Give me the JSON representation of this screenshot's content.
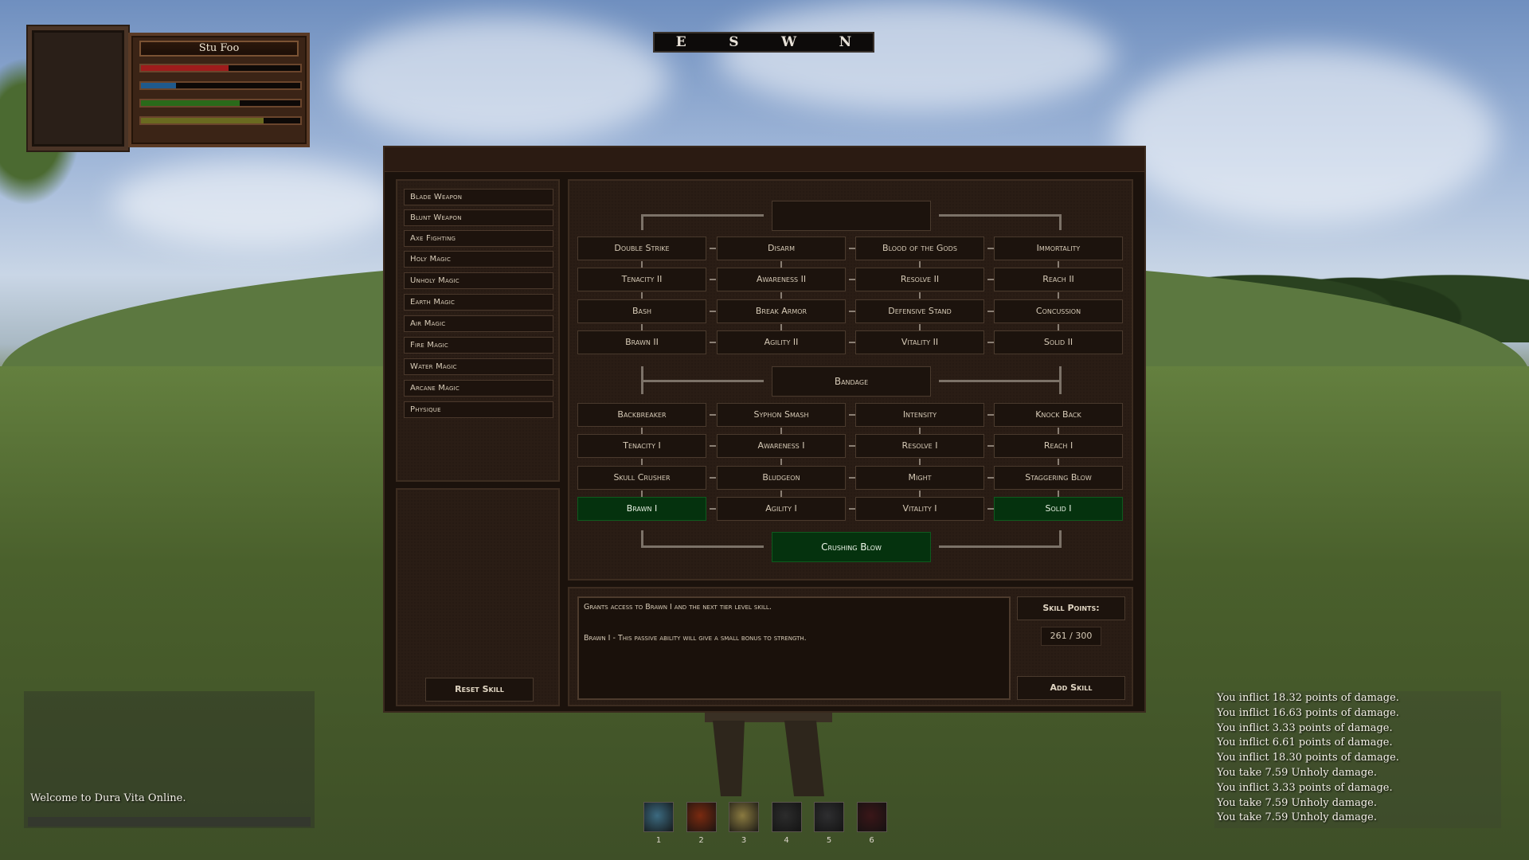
{
  "player": {
    "name": "Stu Foo",
    "health": 0.55,
    "mana": 0.22,
    "stamina": 0.62,
    "experience": 0.77
  },
  "compass": [
    "E",
    "S",
    "W",
    "N"
  ],
  "categories": [
    "Blade Weapon",
    "Blunt Weapon",
    "Axe Fighting",
    "Holy Magic",
    "Unholy Magic",
    "Earth Magic",
    "Air Magic",
    "Fire Magic",
    "Water Magic",
    "Arcane Magic",
    "Physique"
  ],
  "tree": {
    "tier3": {
      "label": "",
      "active": false
    },
    "upper_rows": [
      [
        "Double Strike",
        "Disarm",
        "Blood of the Gods",
        "Immortality"
      ],
      [
        "Tenacity II",
        "Awareness II",
        "Resolve II",
        "Reach II"
      ],
      [
        "Bash",
        "Break Armor",
        "Defensive Stand",
        "Concussion"
      ],
      [
        "Brawn II",
        "Agility II",
        "Vitality II",
        "Solid II"
      ]
    ],
    "tier2": {
      "label": "Bandage",
      "active": false
    },
    "lower_rows": [
      [
        "Backbreaker",
        "Syphon Smash",
        "Intensity",
        "Knock Back"
      ],
      [
        "Tenacity I",
        "Awareness I",
        "Resolve I",
        "Reach I"
      ],
      [
        "Skull Crusher",
        "Bludgeon",
        "Might",
        "Staggering Blow"
      ],
      [
        "Brawn I",
        "Agility I",
        "Vitality I",
        "Solid I"
      ]
    ],
    "tier1": {
      "label": "Crushing Blow",
      "active": true
    },
    "active_nodes": [
      "Brawn I",
      "Solid I"
    ]
  },
  "description": {
    "line1": "Grants access to Brawn I and the next tier level skill.",
    "line2": "Brawn I - This passive ability will give a small bonus to strength."
  },
  "buttons": {
    "reset": "Reset Skill",
    "add": "Add Skill",
    "skill_points_label": "Skill Points:",
    "skill_points_value": "261 / 300"
  },
  "chat": {
    "message": "Welcome to Dura Vita Online."
  },
  "combat_log": [
    "You inflict 18.32 points of damage.",
    "You inflict 16.63 points of damage.",
    "You inflict 3.33 points of damage.",
    "You inflict 6.61 points of damage.",
    "You inflict 18.30 points of damage.",
    "You take 7.59 Unholy damage.",
    "You inflict 3.33 points of damage.",
    "You take 7.59 Unholy damage.",
    "You take 7.59 Unholy damage."
  ],
  "hotbar": [
    {
      "num": "1",
      "icon": "swirl-ability-icon",
      "color": "#3c6a80"
    },
    {
      "num": "2",
      "icon": "fireball-icon",
      "color": "#7a2a10"
    },
    {
      "num": "3",
      "icon": "lightning-icon",
      "color": "#8a7a40"
    },
    {
      "num": "4",
      "icon": "empty-slot-icon",
      "color": "#2c2c2c"
    },
    {
      "num": "5",
      "icon": "empty-slot-icon",
      "color": "#2e2e30"
    },
    {
      "num": "6",
      "icon": "blood-ability-icon",
      "color": "#3a1618"
    }
  ],
  "colors": {
    "active_green": "#05320e",
    "panel_brown": "#2a1d15",
    "health": "#9e1c1c",
    "mana": "#1f5a8c",
    "stamina": "#2a6a1a",
    "experience": "#6a6a20"
  }
}
